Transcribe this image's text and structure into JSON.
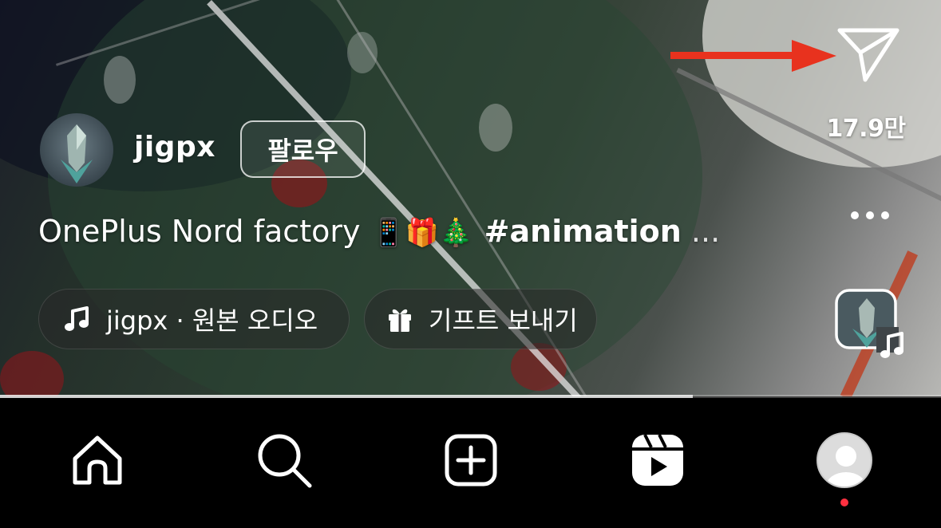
{
  "reel": {
    "share_count": "17.9만",
    "username": "jigpx",
    "follow_label": "팔로우",
    "caption": {
      "text": "OnePlus Nord factory",
      "emojis": "📱🎁🎄",
      "hashtag": "#animation",
      "ellipsis": "..."
    },
    "audio": {
      "label": "jigpx · 원본 오디오"
    },
    "gift": {
      "label": "기프트 보내기"
    },
    "progress_fraction": 0.736
  },
  "icons": {
    "share": "paper-plane-icon",
    "more": "ellipsis-icon",
    "music": "music-note-icon",
    "gift": "gift-icon",
    "annotation": "red-arrow"
  },
  "tabbar": {
    "items": [
      {
        "name": "home",
        "icon": "home-icon"
      },
      {
        "name": "search",
        "icon": "search-icon"
      },
      {
        "name": "create",
        "icon": "plus-square-icon"
      },
      {
        "name": "reels",
        "icon": "reels-icon"
      },
      {
        "name": "profile",
        "icon": "profile-avatar-icon"
      }
    ]
  },
  "colors": {
    "annotation_arrow": "#e8321e",
    "notification_dot": "#ff3040"
  }
}
